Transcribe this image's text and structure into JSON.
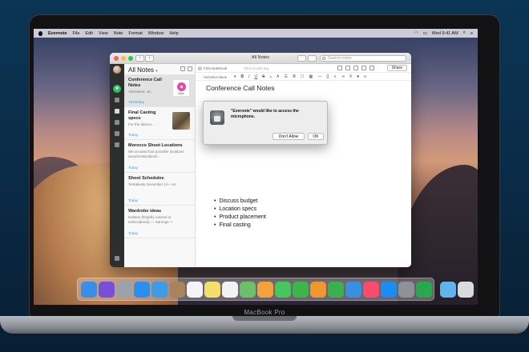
{
  "menubar": {
    "app_name": "Evernote",
    "menus": [
      "File",
      "Edit",
      "View",
      "Note",
      "Format",
      "Window",
      "Help"
    ],
    "clock": "Wed 9:41 AM"
  },
  "window": {
    "title": "All Notes",
    "search_placeholder": "Search notes",
    "nav_back": "‹",
    "nav_forward": "›"
  },
  "sidebar": {
    "new_note_label": "+"
  },
  "note_list": {
    "heading": "All Notes",
    "notes": [
      {
        "title": "Conference Call Notes",
        "snippet": "Attendees: Ja...",
        "date": "Yesterday",
        "thumb": "music",
        "thumb_label": "Mike"
      },
      {
        "title": "Final Casting specs",
        "snippet": "For the dancer...",
        "date": "Today",
        "thumb": "photo"
      },
      {
        "title": "Morocco Shoot Locations",
        "snippet": "We scouted four possible locations around Marrakesh...",
        "date": "Today"
      },
      {
        "title": "Shoot Schedules",
        "snippet": "Tentatively November 12—16",
        "date": "Today"
      },
      {
        "title": "Wardrobe ideas",
        "snippet": "Kaftans (brightly colored or embroidered) — Sarongs —",
        "date": "Today"
      }
    ]
  },
  "editor": {
    "notebook": "First Notebook",
    "tag_placeholder": "Click to add tag",
    "share_label": "Share",
    "font": "Helvetica Neue",
    "note_title": "Conference Call Notes",
    "bullets": [
      "Discuss budget",
      "Location specs",
      "Product placement",
      "Final casting"
    ]
  },
  "alert": {
    "message": "\"Evernote\" would like to access the microphone.",
    "deny_label": "Don't Allow",
    "ok_label": "OK"
  },
  "laptop": {
    "brand": "MacBook Pro"
  },
  "dock": {
    "apps": [
      {
        "name": "finder",
        "color": "#3a8ee6"
      },
      {
        "name": "siri",
        "color": "#7a4fd8"
      },
      {
        "name": "launchpad",
        "color": "#9aa3ad"
      },
      {
        "name": "safari",
        "color": "#2b8ff0"
      },
      {
        "name": "mail",
        "color": "#3f9be8"
      },
      {
        "name": "contacts",
        "color": "#a9835a"
      },
      {
        "name": "calendar",
        "color": "#f4f4f4"
      },
      {
        "name": "notes",
        "color": "#f3df6a"
      },
      {
        "name": "reminders",
        "color": "#f2f2f2"
      },
      {
        "name": "maps",
        "color": "#6cc06a"
      },
      {
        "name": "photos",
        "color": "#f1a23b"
      },
      {
        "name": "messages",
        "color": "#45c75c"
      },
      {
        "name": "facetime",
        "color": "#3cb54a"
      },
      {
        "name": "pages",
        "color": "#f0962e"
      },
      {
        "name": "numbers",
        "color": "#3ab04f"
      },
      {
        "name": "keynote",
        "color": "#3b8fe0"
      },
      {
        "name": "music",
        "color": "#fb4a6b"
      },
      {
        "name": "app-store",
        "color": "#1c8cf0"
      },
      {
        "name": "system-preferences",
        "color": "#8d9299"
      },
      {
        "name": "evernote",
        "color": "#2aa84f"
      },
      {
        "name": "downloads-folder",
        "color": "#5fb4ee"
      },
      {
        "name": "trash",
        "color": "#d8dadd"
      }
    ]
  }
}
